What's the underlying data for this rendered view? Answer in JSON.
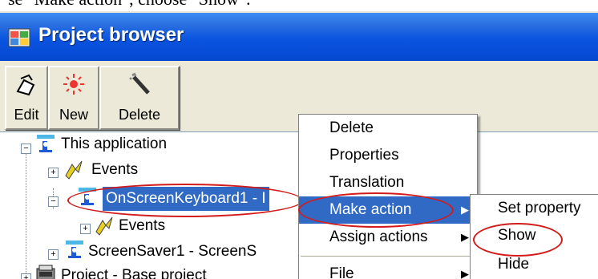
{
  "caption": "se \"Make action\", choose \"Show\":",
  "window": {
    "title": "Project browser"
  },
  "toolbar": {
    "edit_label": "Edit",
    "new_label": "New",
    "delete_label": "Delete"
  },
  "tree": {
    "root_label": "This application",
    "events1_label": "Events",
    "selected_label": "OnScreenKeyboard1 - I",
    "events2_label": "Events",
    "screensaver_label": "ScreenSaver1 - ScreenS",
    "project_label": "Project - Base project"
  },
  "context_menu": {
    "items": [
      "Delete",
      "Properties",
      "Translation",
      "Make action",
      "Assign actions",
      "File"
    ]
  },
  "submenu": {
    "items": [
      "Set property",
      "Show",
      "Hide"
    ]
  },
  "colors": {
    "titlebar": "#0a54e0",
    "selection": "#316ac5",
    "highlight_ellipse": "#d21c1c"
  }
}
